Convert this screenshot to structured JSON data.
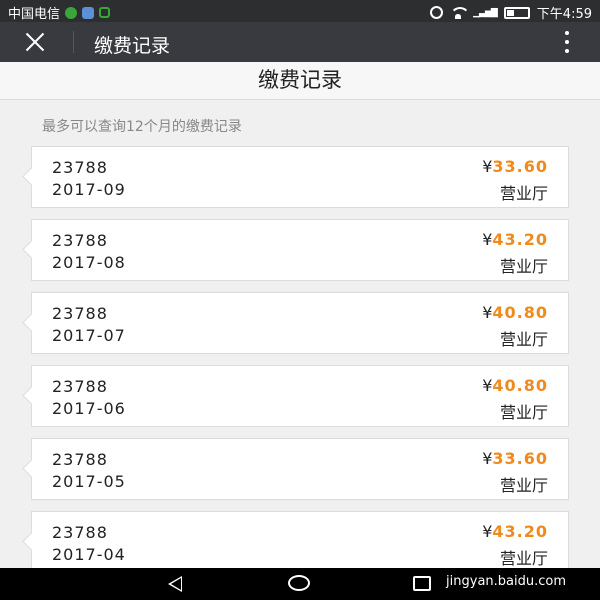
{
  "status_bar": {
    "carrier": "中国电信",
    "time": "下午4:59",
    "icons": [
      "chat-icon",
      "app-icon",
      "lock-icon",
      "alarm-icon",
      "wifi-icon",
      "signal-icon",
      "battery-icon"
    ]
  },
  "title_bar": {
    "title": "缴费记录"
  },
  "page": {
    "heading": "缴费记录",
    "hint": "最多可以查询12个月的缴费记录"
  },
  "records": [
    {
      "account": "23788",
      "month": "2017-09",
      "currency": "¥",
      "amount": "33.60",
      "channel": "营业厅"
    },
    {
      "account": "23788",
      "month": "2017-08",
      "currency": "¥",
      "amount": "43.20",
      "channel": "营业厅"
    },
    {
      "account": "23788",
      "month": "2017-07",
      "currency": "¥",
      "amount": "40.80",
      "channel": "营业厅"
    },
    {
      "account": "23788",
      "month": "2017-06",
      "currency": "¥",
      "amount": "40.80",
      "channel": "营业厅"
    },
    {
      "account": "23788",
      "month": "2017-05",
      "currency": "¥",
      "amount": "33.60",
      "channel": "营业厅"
    },
    {
      "account": "23788",
      "month": "2017-04",
      "currency": "¥",
      "amount": "43.20",
      "channel": "营业厅"
    }
  ],
  "watermark": "jingyan.baidu.com",
  "colors": {
    "amount": "#f08a1c",
    "title_bar": "#393a3f"
  }
}
